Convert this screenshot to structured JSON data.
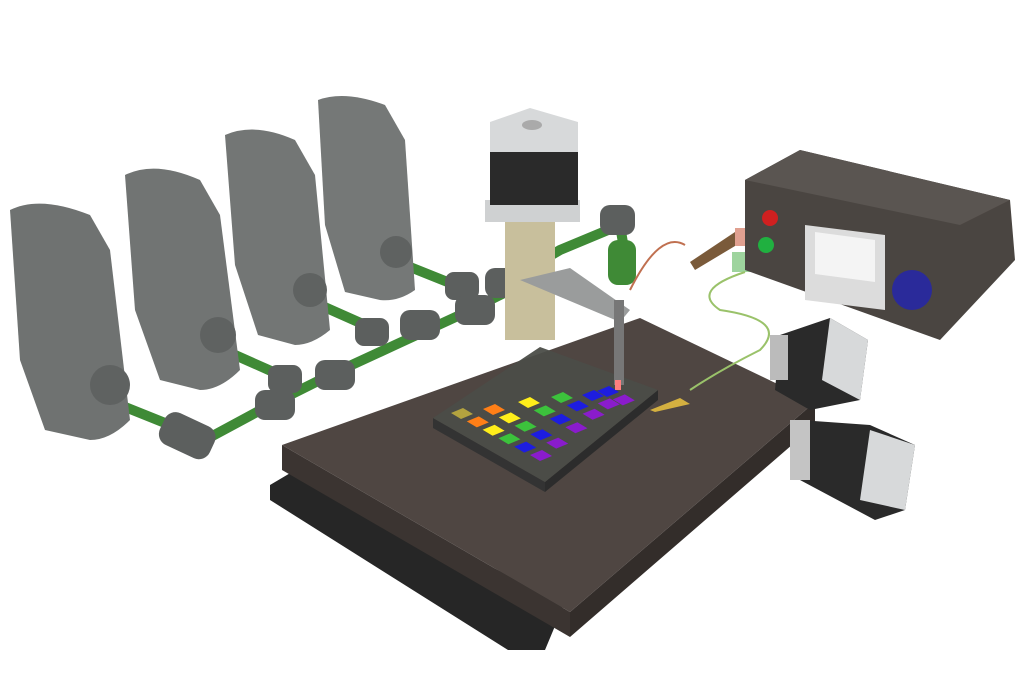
{
  "colors": {
    "board": "#4f4642",
    "board_side": "#3b3431",
    "base_plate": "#262626",
    "pump": "#6f7271",
    "tube": "#3f8a36",
    "connector": "#5c5f5e",
    "column": "#c8bf9c",
    "motor_body": "#2a2a2a",
    "motor_cap": "#d7d9da",
    "psu_box": "#4a4541",
    "knob": "#2a2a9a"
  },
  "well_grid": [
    [
      "#b3a33f",
      "#ff7f17",
      "#ffee1a",
      "#3cc23c",
      "#1d1de0",
      "#8a1ccc"
    ],
    [
      "#ff7f17",
      "#ffee1a",
      "#3cc23c",
      "#1d1de0",
      "#8a1ccc"
    ],
    [
      "#ffee1a",
      "#3cc23c",
      "#1d1de0",
      "#8a1ccc"
    ],
    [
      "#3cc23c",
      "#1d1de0",
      "#8a1ccc"
    ],
    [
      "#1d1de0",
      "#8a1ccc"
    ],
    [
      "#1d1de0",
      "#8a1ccc"
    ]
  ]
}
